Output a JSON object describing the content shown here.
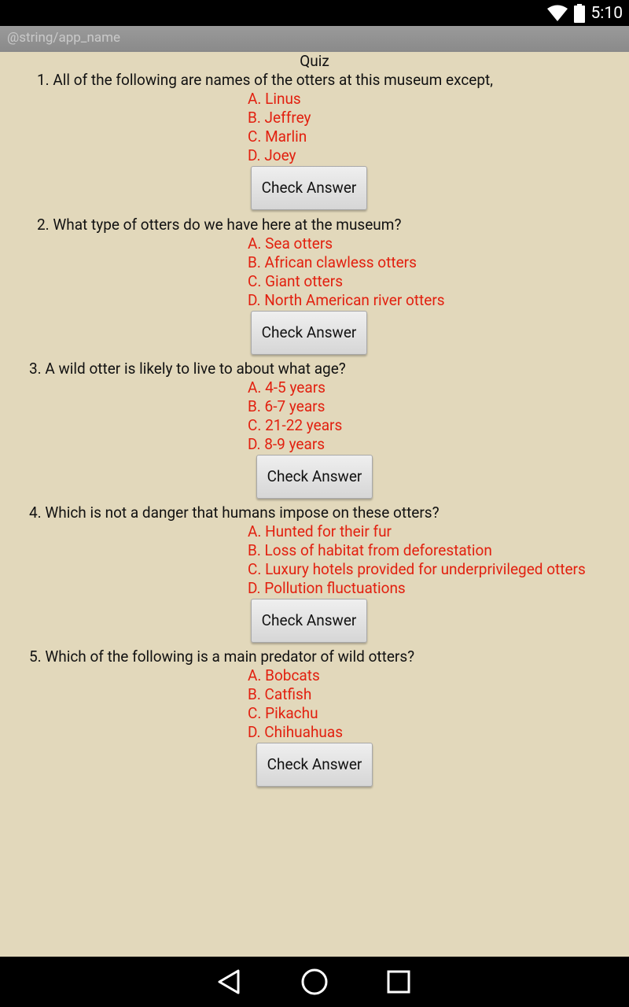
{
  "status_bar": {
    "time": "5:10",
    "icons": [
      "wifi-icon",
      "battery-icon"
    ]
  },
  "app_bar": {
    "title": "@string/app_name"
  },
  "quiz": {
    "title": "Quiz",
    "questions": [
      {
        "text": "1. All of the following are names of the otters at this museum except,",
        "options": [
          "A. Linus",
          "B. Jeffrey",
          "C. Marlin",
          "D. Joey"
        ],
        "button": "Check Answer"
      },
      {
        "text": "2. What type of otters do we have here at the museum?",
        "options": [
          "A. Sea otters",
          "B. African clawless otters",
          "C. Giant otters",
          "D. North American river otters"
        ],
        "button": "Check Answer"
      },
      {
        "text": "3. A wild otter is likely to live to about what age?",
        "options": [
          "A. 4-5 years",
          "B. 6-7 years",
          "C. 21-22 years",
          "D. 8-9 years"
        ],
        "button": "Check Answer"
      },
      {
        "text": "4. Which is not a danger that humans impose on these otters?",
        "options": [
          "A. Hunted for their fur",
          "B. Loss of habitat from deforestation",
          "C. Luxury hotels provided for underprivileged otters",
          "D. Pollution fluctuations"
        ],
        "button": "Check Answer"
      },
      {
        "text": "5. Which of the following is a main predator of wild otters?",
        "options": [
          "A. Bobcats",
          "B. Catfish",
          "C. Pikachu",
          "D. Chihuahuas"
        ],
        "button": "Check Answer"
      }
    ]
  },
  "colors": {
    "background": "#e2d8bb",
    "option_text": "#e2200f",
    "app_bar": "#8f8f8f"
  },
  "nav_bar": {
    "icons": [
      "back-icon",
      "home-icon",
      "recents-icon"
    ]
  }
}
